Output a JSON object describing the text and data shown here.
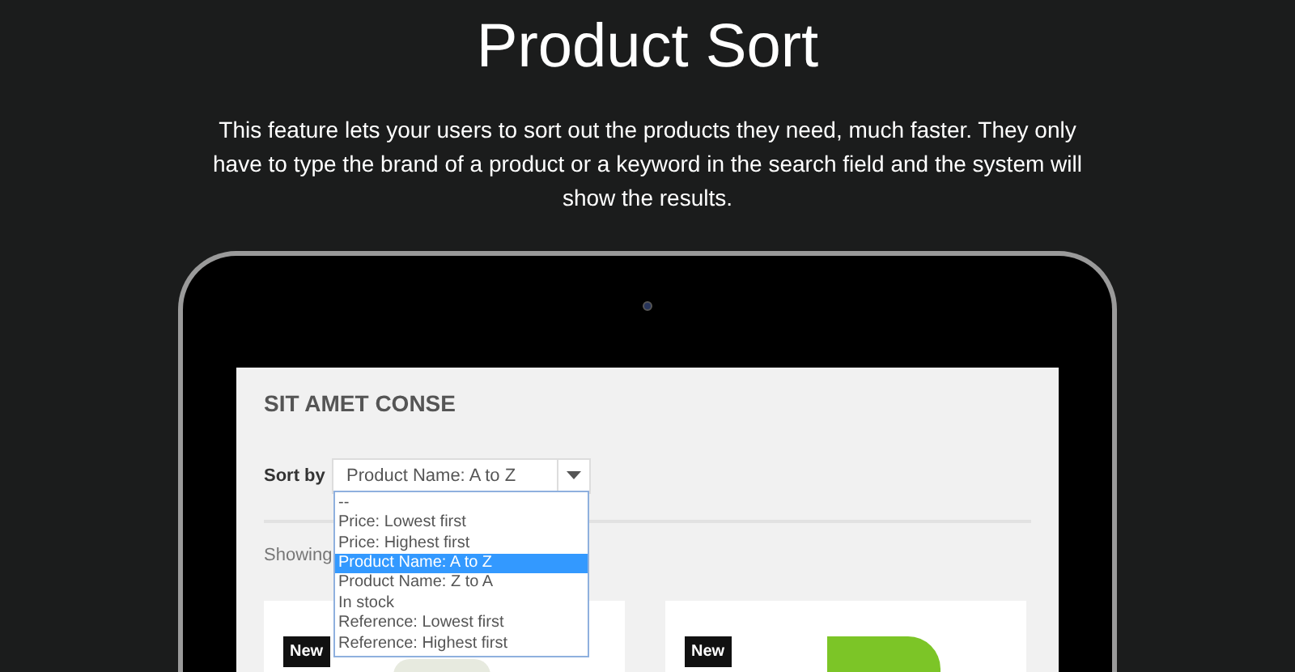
{
  "title": "Product Sort",
  "description": "This feature lets your users to sort out the products they need, much faster. They only have to type the brand of a product or a keyword in the search field and the system will show the results.",
  "screen": {
    "heading": "SIT AMET CONSE",
    "sort_label": "Sort by",
    "sort_select": {
      "value": "Product Name: A to Z",
      "expanded": true,
      "options": [
        {
          "label": "--",
          "selected": false
        },
        {
          "label": "Price: Lowest first",
          "selected": false
        },
        {
          "label": "Price: Highest first",
          "selected": false
        },
        {
          "label": "Product Name: A to Z",
          "selected": true
        },
        {
          "label": "Product Name: Z to A",
          "selected": false
        },
        {
          "label": "In stock",
          "selected": false
        },
        {
          "label": "Reference: Lowest first",
          "selected": false
        },
        {
          "label": "Reference: Highest first",
          "selected": false
        }
      ]
    },
    "showing": "Showing",
    "products": [
      {
        "badge": "New"
      },
      {
        "badge": "New"
      }
    ]
  }
}
